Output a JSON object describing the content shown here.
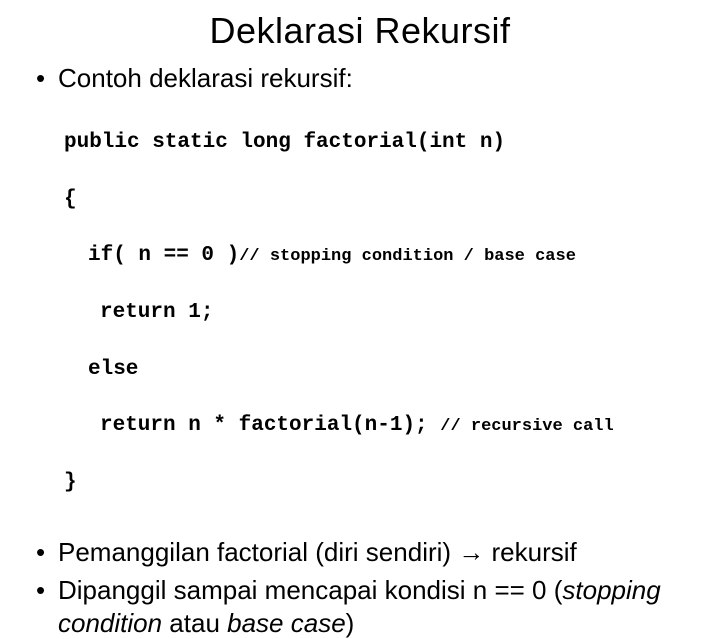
{
  "title": "Deklarasi Rekursif",
  "bullets": {
    "b1": "Contoh deklarasi rekursif:",
    "b2_pre": "Pemanggilan factorial (diri sendiri) ",
    "b2_arrow": "→",
    "b2_post": " rekursif",
    "b3_pre": "Dipanggil sampai mencapai kondisi n == 0 (",
    "b3_italic1": "stopping condition",
    "b3_mid": " atau ",
    "b3_italic2": "base case",
    "b3_post": ")"
  },
  "code": {
    "l1": "public static long factorial(int n)",
    "l2": "{",
    "l3a": "if( n == 0 )",
    "l3b": "// stopping condition / base case",
    "l4": "return 1;",
    "l5": "else",
    "l6a": "return n * factorial(n-1); ",
    "l6b": "// recursive call",
    "l7": "}"
  }
}
